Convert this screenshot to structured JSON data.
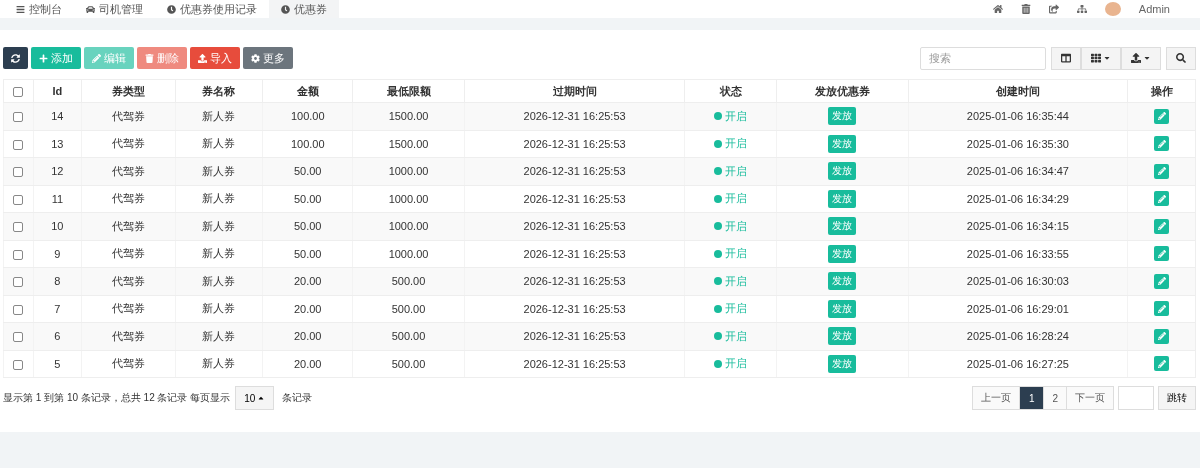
{
  "nav": {
    "tabs": [
      {
        "label": "控制台",
        "selected": false
      },
      {
        "label": "司机管理",
        "selected": false
      },
      {
        "label": "优惠券使用记录",
        "selected": false
      },
      {
        "label": "优惠券",
        "selected": true
      }
    ],
    "user": "Admin"
  },
  "toolbar": {
    "buttons": [
      {
        "kind": "refresh",
        "disabled": false
      },
      {
        "kind": "add",
        "label": "添加",
        "disabled": false
      },
      {
        "kind": "edit",
        "label": "编辑",
        "disabled": true
      },
      {
        "kind": "delete",
        "label": "删除",
        "disabled": true
      },
      {
        "kind": "import",
        "label": "导入",
        "disabled": false
      },
      {
        "kind": "more",
        "label": "更多",
        "disabled": false
      }
    ],
    "search": {
      "placeholder": "搜索"
    }
  },
  "table": {
    "columns": [
      "Id",
      "券类型",
      "券名称",
      "金额",
      "最低限额",
      "过期时间",
      "状态",
      "发放优惠券",
      "创建时间",
      "操作"
    ],
    "select_all": false,
    "rows": [
      {
        "checked": false,
        "id": "14",
        "type": "代驾券",
        "name": "新人券",
        "amount": "100.00",
        "min": "1500.00",
        "expire": "2026-12-31 16:25:53",
        "status": "开启",
        "issue": "发放",
        "created": "2025-01-06 16:35:44"
      },
      {
        "checked": false,
        "id": "13",
        "type": "代驾券",
        "name": "新人券",
        "amount": "100.00",
        "min": "1500.00",
        "expire": "2026-12-31 16:25:53",
        "status": "开启",
        "issue": "发放",
        "created": "2025-01-06 16:35:30"
      },
      {
        "checked": false,
        "id": "12",
        "type": "代驾券",
        "name": "新人券",
        "amount": "50.00",
        "min": "1000.00",
        "expire": "2026-12-31 16:25:53",
        "status": "开启",
        "issue": "发放",
        "created": "2025-01-06 16:34:47"
      },
      {
        "checked": false,
        "id": "11",
        "type": "代驾券",
        "name": "新人券",
        "amount": "50.00",
        "min": "1000.00",
        "expire": "2026-12-31 16:25:53",
        "status": "开启",
        "issue": "发放",
        "created": "2025-01-06 16:34:29"
      },
      {
        "checked": false,
        "id": "10",
        "type": "代驾券",
        "name": "新人券",
        "amount": "50.00",
        "min": "1000.00",
        "expire": "2026-12-31 16:25:53",
        "status": "开启",
        "issue": "发放",
        "created": "2025-01-06 16:34:15"
      },
      {
        "checked": false,
        "id": "9",
        "type": "代驾券",
        "name": "新人券",
        "amount": "50.00",
        "min": "1000.00",
        "expire": "2026-12-31 16:25:53",
        "status": "开启",
        "issue": "发放",
        "created": "2025-01-06 16:33:55"
      },
      {
        "checked": false,
        "id": "8",
        "type": "代驾券",
        "name": "新人券",
        "amount": "20.00",
        "min": "500.00",
        "expire": "2026-12-31 16:25:53",
        "status": "开启",
        "issue": "发放",
        "created": "2025-01-06 16:30:03"
      },
      {
        "checked": false,
        "id": "7",
        "type": "代驾券",
        "name": "新人券",
        "amount": "20.00",
        "min": "500.00",
        "expire": "2026-12-31 16:25:53",
        "status": "开启",
        "issue": "发放",
        "created": "2025-01-06 16:29:01"
      },
      {
        "checked": false,
        "id": "6",
        "type": "代驾券",
        "name": "新人券",
        "amount": "20.00",
        "min": "500.00",
        "expire": "2026-12-31 16:25:53",
        "status": "开启",
        "issue": "发放",
        "created": "2025-01-06 16:28:24"
      },
      {
        "checked": false,
        "id": "5",
        "type": "代驾券",
        "name": "新人券",
        "amount": "20.00",
        "min": "500.00",
        "expire": "2026-12-31 16:25:53",
        "status": "开启",
        "issue": "发放",
        "created": "2025-01-06 16:27:25"
      }
    ]
  },
  "footer": {
    "summary": "显示第 1 到第 10 条记录，总共 12 条记录 每页显示",
    "page_size": "10",
    "suffix": "条记录",
    "pages": [
      {
        "label": "上一页",
        "selected": false
      },
      {
        "label": "1",
        "selected": true
      },
      {
        "label": "2",
        "selected": false
      },
      {
        "label": "下一页",
        "selected": false
      }
    ],
    "jump": "跳转"
  }
}
